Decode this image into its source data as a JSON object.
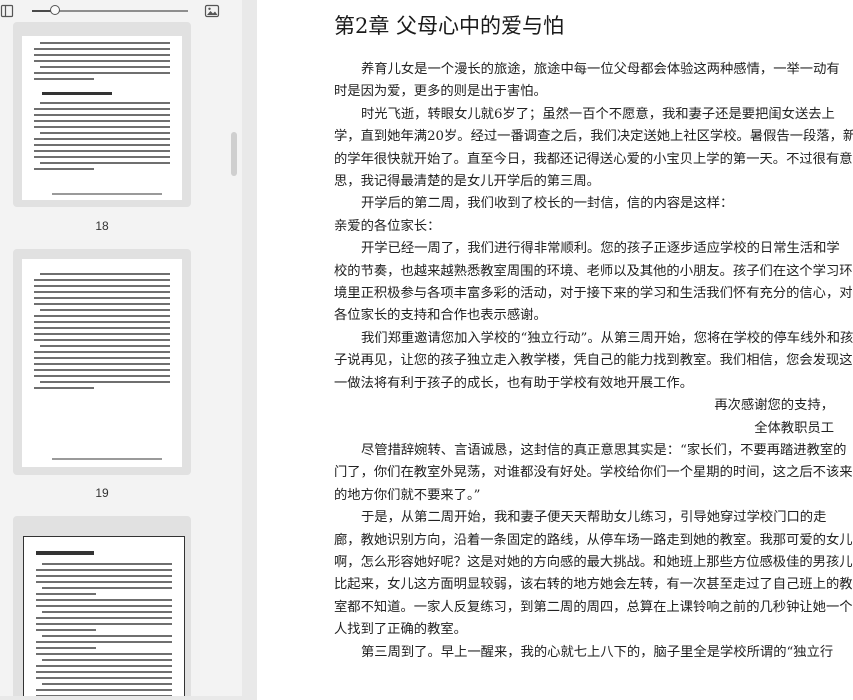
{
  "sidebar": {
    "toolbar": {
      "zoom_level": 0.15,
      "left_icon": "sidebar-toggle-icon",
      "right_icon": "image-icon"
    },
    "thumbnails": [
      {
        "label": "18",
        "selected": false
      },
      {
        "label": "19",
        "selected": false
      },
      {
        "label": "",
        "selected": true
      }
    ]
  },
  "document": {
    "chapter_title": "第2章 父母心中的爱与怕",
    "lines": [
      {
        "text": "养育儿女是一个漫长的旅途，旅途中每一位父母都会体验这两种感情，一举一动有",
        "cls": "ind"
      },
      {
        "text": "时是因为爱，更多的则是出于害怕。",
        "cls": ""
      },
      {
        "text": "时光飞逝，转眼女儿就6岁了；虽然一百个不愿意，我和妻子还是要把闺女送去上",
        "cls": "ind"
      },
      {
        "text": "学，直到她年满20岁。经过一番调查之后，我们决定送她上社区学校。暑假告一段落，新",
        "cls": ""
      },
      {
        "text": "的学年很快就开始了。直至今日，我都还记得送心爱的小宝贝上学的第一天。不过很有意",
        "cls": ""
      },
      {
        "text": "思，我记得最清楚的是女儿开学后的第三周。",
        "cls": ""
      },
      {
        "text": "开学后的第二周，我们收到了校长的一封信，信的内容是这样：",
        "cls": "ind"
      },
      {
        "text": "亲爱的各位家长：",
        "cls": ""
      },
      {
        "text": "开学已经一周了，我们进行得非常顺利。您的孩子正逐步适应学校的日常生活和学",
        "cls": "ind"
      },
      {
        "text": "校的节奏，也越来越熟悉教室周围的环境、老师以及其他的小朋友。孩子们在这个学习环",
        "cls": ""
      },
      {
        "text": "境里正积极参与各项丰富多彩的活动，对于接下来的学习和生活我们怀有充分的信心，对",
        "cls": ""
      },
      {
        "text": "各位家长的支持和合作也表示感谢。",
        "cls": ""
      },
      {
        "text": "我们郑重邀请您加入学校的“独立行动”。从第三周开始，您将在学校的停车线外和孩",
        "cls": "ind"
      },
      {
        "text": "子说再见，让您的孩子独立走入教学楼，凭自己的能力找到教室。我们相信，您会发现这",
        "cls": ""
      },
      {
        "text": "一做法将有利于孩子的成长，也有助于学校有效地开展工作。",
        "cls": ""
      },
      {
        "text": "再次感谢您的支持，",
        "cls": "right"
      },
      {
        "text": "全体教职员工",
        "cls": "right"
      },
      {
        "text": "尽管措辞婉转、言语诚恳，这封信的真正意思其实是：“家长们，不要再踏进教室的",
        "cls": "ind"
      },
      {
        "text": "门了，你们在教室外晃荡，对谁都没有好处。学校给你们一个星期的时间，这之后不该来",
        "cls": ""
      },
      {
        "text": "的地方你们就不要来了。”",
        "cls": ""
      },
      {
        "text": "于是，从第二周开始，我和妻子便天天帮助女儿练习，引导她穿过学校门口的走",
        "cls": "ind"
      },
      {
        "text": "廊，教她识别方向，沿着一条固定的路线，从停车场一路走到她的教室。我那可爱的女儿",
        "cls": ""
      },
      {
        "text": "啊，怎么形容她好呢？这是对她的方向感的最大挑战。和她班上那些方位感极佳的男孩儿",
        "cls": ""
      },
      {
        "text": "比起来，女儿这方面明显较弱，该右转的地方她会左转，有一次甚至走过了自己班上的教",
        "cls": ""
      },
      {
        "text": "室都不知道。一家人反复练习，到第二周的周四，总算在上课铃响之前的几秒钟让她一个",
        "cls": ""
      },
      {
        "text": "人找到了正确的教室。",
        "cls": ""
      },
      {
        "text": "第三周到了。早上一醒来，我的心就七上八下的，脑子里全是学校所谓的“独立行",
        "cls": "ind"
      }
    ]
  }
}
